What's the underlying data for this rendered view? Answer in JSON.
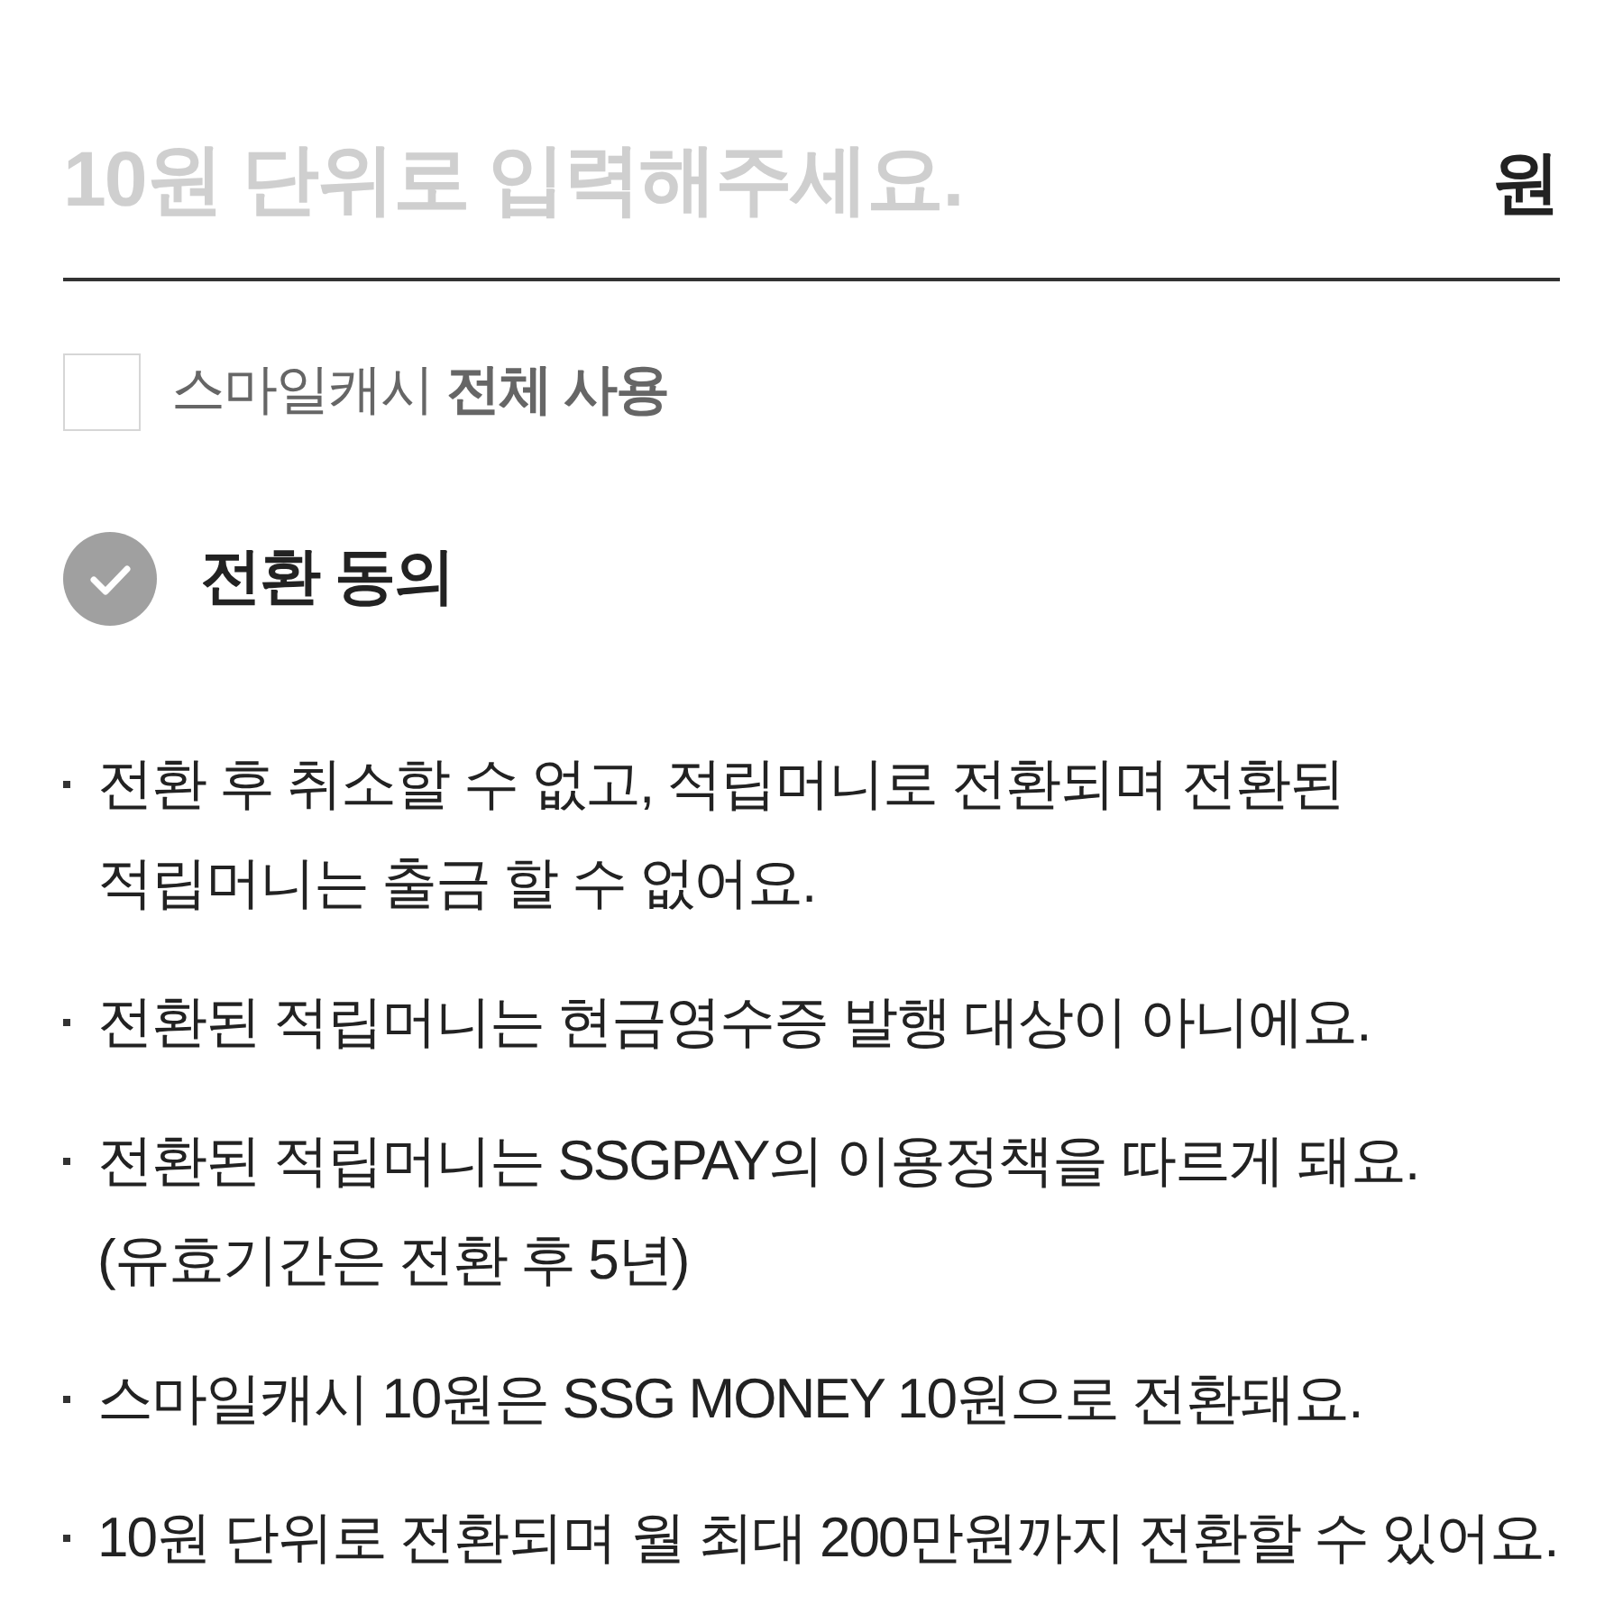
{
  "amount_input": {
    "placeholder": "10원 단위로 입력해주세요.",
    "unit": "원"
  },
  "use_all": {
    "label": "스마일캐시 **전체 사용**",
    "checked": false
  },
  "agreement": {
    "title": "전환 동의",
    "checked": false
  },
  "notices": [
    "전환 후 취소할 수 없고, 적립머니로 전환되며 전환된\n적립머니는 출금 할 수 없어요.",
    "전환된 적립머니는 현금영수증 발행 대상이 아니에요.",
    "전환된 적립머니는 SSGPAY의 이용정책을 따르게 돼요.\n(유효기간은 전환 후 5년)",
    "스마일캐시 10원은 SSG MONEY 10원으로 전환돼요.",
    "10원 단위로 전환되며 월 최대 200만원까지 전환할 수 있어요."
  ]
}
